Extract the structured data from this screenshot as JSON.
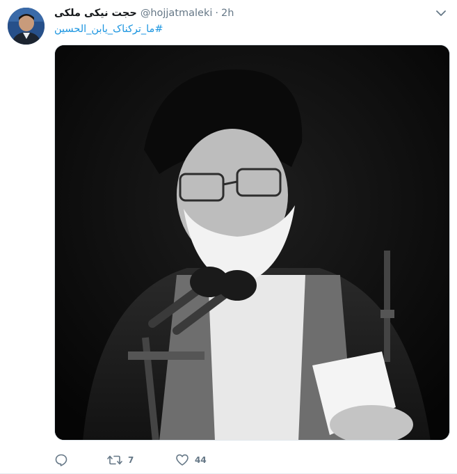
{
  "tweet": {
    "display_name": "حجت نیکی ملکی",
    "handle": "@hojjatmaleki",
    "separator": "·",
    "timestamp": "2h",
    "hashtag": "#ما_ترکناک_یابن_الحسین"
  },
  "actions": {
    "reply_count": "",
    "retweet_count": "7",
    "like_count": "44"
  },
  "icons": {
    "avatar": "user-avatar",
    "caret": "chevron-down-icon",
    "reply": "reply-icon",
    "retweet": "retweet-icon",
    "like": "heart-icon"
  },
  "colors": {
    "link": "#1b95e0",
    "secondary_text": "#657786",
    "primary_text": "#14171a"
  }
}
